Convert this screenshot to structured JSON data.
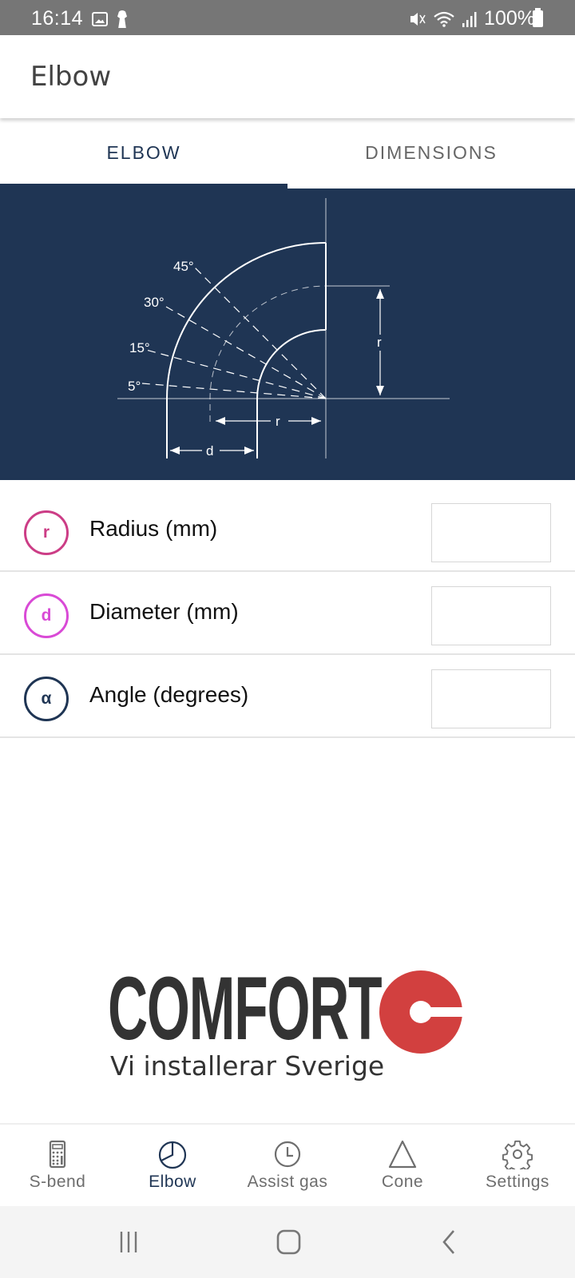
{
  "status_bar": {
    "time": "16:14",
    "battery": "100%",
    "icons": [
      "image-icon",
      "keyhole-icon",
      "mute-icon",
      "wifi-icon",
      "signal-icon",
      "battery-icon"
    ]
  },
  "app_bar": {
    "title": "Elbow"
  },
  "tabs": [
    {
      "label": "ELBOW",
      "active": true
    },
    {
      "label": "DIMENSIONS",
      "active": false
    }
  ],
  "diagram": {
    "angle_labels": [
      "45°",
      "30°",
      "15°",
      "5°"
    ],
    "dimension_labels": {
      "radius_horizontal": "r",
      "radius_vertical": "r",
      "diameter": "d"
    },
    "background_color": "#1f3554"
  },
  "fields": [
    {
      "symbol": "r",
      "label": "Radius (mm)",
      "value": "",
      "color": "#cc3d86"
    },
    {
      "symbol": "d",
      "label": "Diameter (mm)",
      "value": "",
      "color": "#d94ad6"
    },
    {
      "symbol": "α",
      "label": "Angle (degrees)",
      "value": "",
      "color": "#1f3554"
    }
  ],
  "logo": {
    "wordmark": "COMFORT",
    "tagline": "Vi installerar Sverige",
    "brand_color": "#d2403f"
  },
  "bottom_nav": [
    {
      "label": "S-bend",
      "icon": "calculator-icon",
      "active": false
    },
    {
      "label": "Elbow",
      "icon": "pie-chart-icon",
      "active": true
    },
    {
      "label": "Assist gas",
      "icon": "clock-icon",
      "active": false
    },
    {
      "label": "Cone",
      "icon": "triangle-icon",
      "active": false
    },
    {
      "label": "Settings",
      "icon": "gear-icon",
      "active": false
    }
  ],
  "system_nav": [
    "recents-button",
    "home-button",
    "back-button"
  ]
}
